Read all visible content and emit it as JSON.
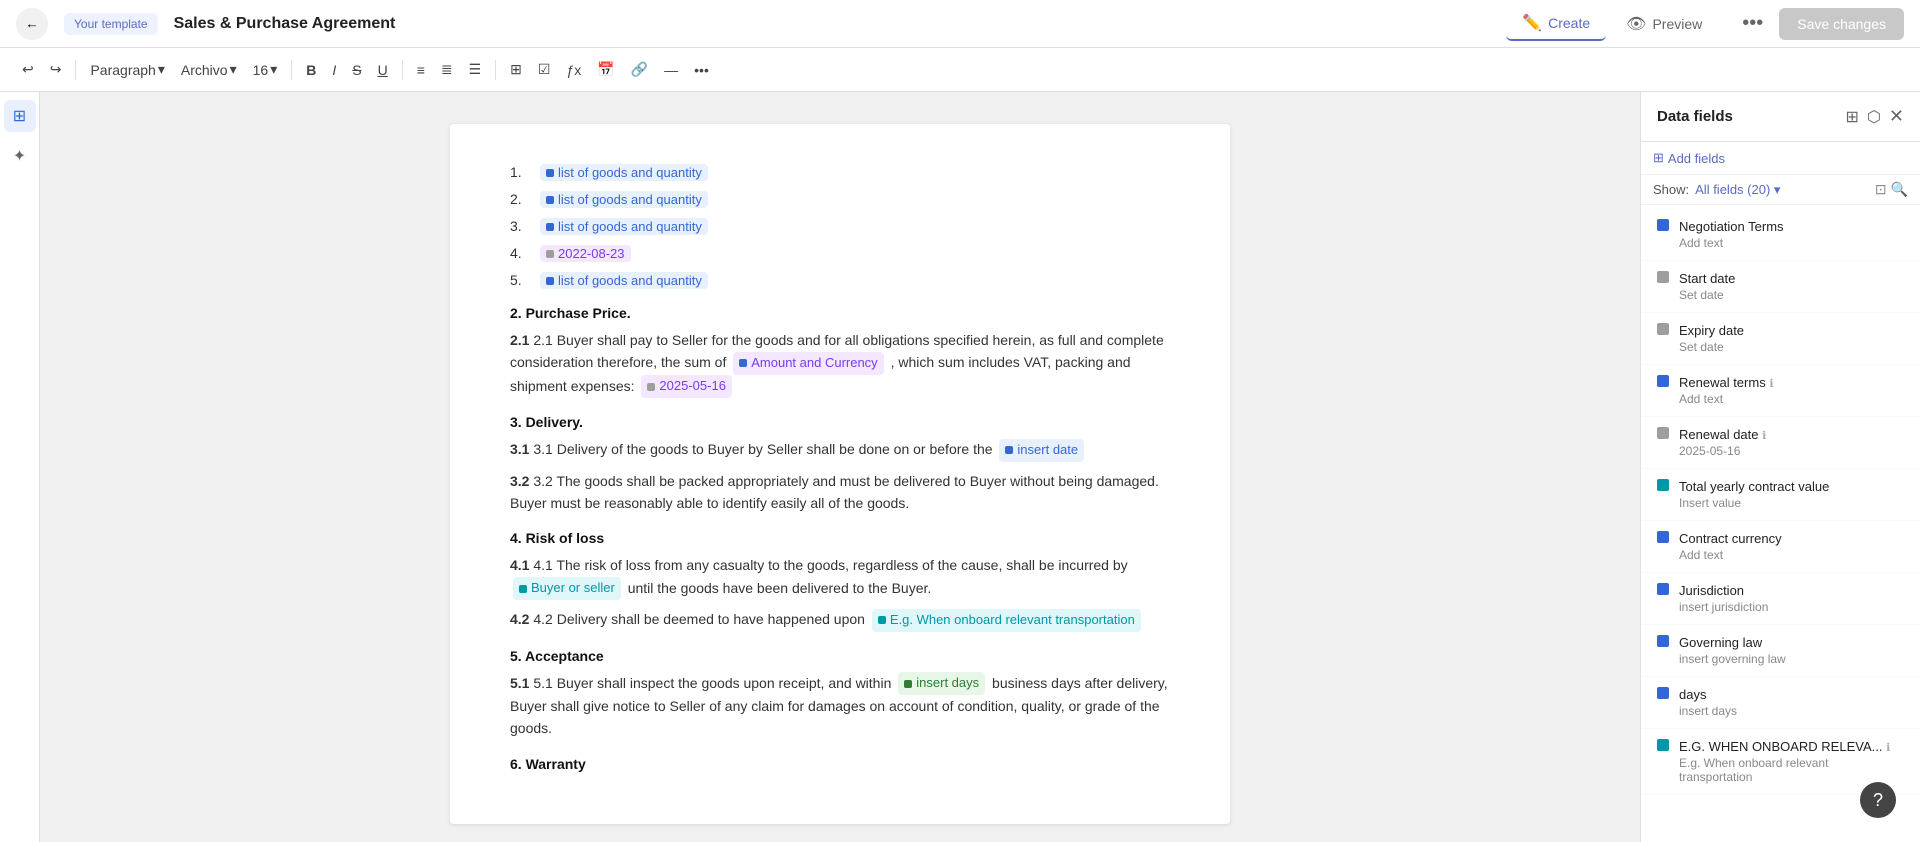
{
  "topbar": {
    "back_label": "←",
    "template_badge": "Your template",
    "doc_title": "Sales & Purchase Agreement",
    "tab_create": "Create",
    "tab_preview": "Preview",
    "more_label": "•••",
    "save_label": "Save changes"
  },
  "toolbar": {
    "undo": "↩",
    "redo": "↪",
    "paragraph_label": "Paragraph",
    "font_label": "Archivo",
    "size_label": "16",
    "bold": "B",
    "italic": "I",
    "strikethrough": "S",
    "underline": "U",
    "align": "≡",
    "list_ordered": "≡",
    "list_bullet": "≡",
    "more": "•••"
  },
  "document": {
    "items": [
      {
        "num": "1.",
        "type": "chip-blue",
        "label": "list of goods and quantity"
      },
      {
        "num": "2.",
        "type": "chip-blue",
        "label": "list of goods and quantity"
      },
      {
        "num": "3.",
        "type": "chip-blue",
        "label": "list of goods and quantity"
      },
      {
        "num": "4.",
        "type": "chip-gray",
        "label": "2022-08-23"
      },
      {
        "num": "5.",
        "type": "chip-blue",
        "label": "list of goods and quantity"
      }
    ],
    "section2": {
      "heading": "2. Purchase Price.",
      "para21_pre": "2.1 Buyer shall pay to Seller for the goods and for all obligations specified herein, as full and complete consideration therefore, the sum of",
      "para21_chip1": "Amount and Currency",
      "para21_mid": ", which sum includes VAT, packing and shipment expenses:",
      "para21_chip2": "2025-05-16"
    },
    "section3": {
      "heading": "3. Delivery.",
      "para31_pre": "3.1 Delivery of the goods to Buyer by Seller shall be done on or before the",
      "para31_chip": "insert date",
      "para32": "3.2 The goods shall be packed appropriately and must be delivered to Buyer without being damaged. Buyer must be reasonably able to identify easily all of the goods."
    },
    "section4": {
      "heading": "4. Risk of loss",
      "para41_pre": "4.1 The risk of loss from any casualty to the goods, regardless of the cause, shall be incurred by",
      "para41_chip": "Buyer or seller",
      "para41_post": "until the goods have been delivered to the Buyer.",
      "para42_pre": "4.2 Delivery shall be deemed to have happened upon",
      "para42_chip": "E.g. When onboard relevant transportation"
    },
    "section5": {
      "heading": "5. Acceptance",
      "para51_pre": "5.1 Buyer shall inspect the goods upon receipt, and within",
      "para51_chip": "insert days",
      "para51_post": "business days after delivery, Buyer shall give notice to Seller of any claim for damages on account of condition, quality, or grade of the goods."
    },
    "section6": {
      "heading": "6. Warranty"
    }
  },
  "right_panel": {
    "title": "Data fields",
    "add_fields_label": "Add fields",
    "filter_show": "Show:",
    "filter_value": "All fields (20)",
    "fields": [
      {
        "name": "Negotiation Terms",
        "value": "Add text",
        "color": "blue"
      },
      {
        "name": "Start date",
        "value": "Set date",
        "color": "gray"
      },
      {
        "name": "Expiry date",
        "value": "Set date",
        "color": "gray"
      },
      {
        "name": "Renewal terms",
        "value": "Add text",
        "color": "blue",
        "info": true
      },
      {
        "name": "Renewal date",
        "value": "2025-05-16",
        "color": "gray",
        "info": true
      },
      {
        "name": "Total yearly contract value",
        "value": "Insert value",
        "color": "teal"
      },
      {
        "name": "Contract currency",
        "value": "Add text",
        "color": "blue"
      },
      {
        "name": "Jurisdiction",
        "value": "insert jurisdiction",
        "color": "blue"
      },
      {
        "name": "Governing law",
        "value": "insert governing law",
        "color": "blue"
      },
      {
        "name": "days",
        "value": "insert days",
        "color": "blue"
      },
      {
        "name": "E.G. WHEN ONBOARD RELEVA...",
        "value": "E.g. When onboard relevant transportation",
        "color": "teal",
        "info": true
      }
    ]
  }
}
